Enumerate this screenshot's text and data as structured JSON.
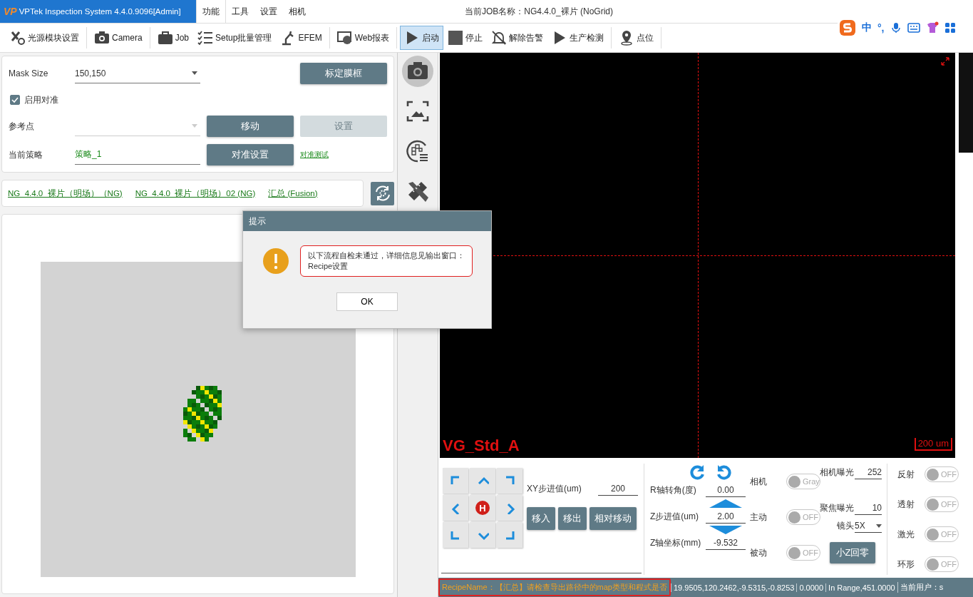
{
  "title_bar": {
    "logo": "VP",
    "app_title": "VPTek Inspection System 4.4.0.9096[Admin]",
    "menu": [
      {
        "label": "功能",
        "selected": true
      },
      {
        "label": "工具",
        "selected": false
      },
      {
        "label": "设置",
        "selected": false
      },
      {
        "label": "相机",
        "selected": false
      }
    ],
    "job_name": "当前JOB名称：NG4.4.0_裸片 (NoGrid)"
  },
  "ime_bar": {
    "items": [
      "中",
      "°,"
    ]
  },
  "toolbar": [
    {
      "items": [
        {
          "label": "光源模块设置",
          "selected": false
        }
      ]
    },
    {
      "items": [
        {
          "label": "Camera",
          "selected": false
        }
      ]
    },
    {
      "items": [
        {
          "label": "Job",
          "selected": false
        },
        {
          "label": "Setup批量管理",
          "selected": false
        },
        {
          "label": "EFEM",
          "selected": false
        }
      ]
    },
    {
      "items": [
        {
          "label": "Web报表",
          "selected": false
        }
      ]
    },
    {
      "items": [
        {
          "label": "启动",
          "selected": true
        },
        {
          "label": "停止",
          "selected": false
        },
        {
          "label": "解除告警",
          "selected": false
        },
        {
          "label": "生产检测",
          "selected": false
        }
      ]
    },
    {
      "items": [
        {
          "label": "点位",
          "selected": false
        }
      ]
    }
  ],
  "alignment": {
    "mask_size": {
      "label": "Mask Size",
      "value": "150,150"
    },
    "calibrate_button": "标定膜框",
    "enable_align": {
      "label": "启用对准",
      "checked": true
    },
    "ref_point": {
      "label": "参考点",
      "disabled": true
    },
    "move_button": {
      "label": "移动",
      "disabled": false
    },
    "set_button": {
      "label": "设置",
      "disabled": true
    },
    "strategy": {
      "label": "当前策略",
      "value": "策略_1"
    },
    "align_settings_button": "对准设置",
    "align_test_link": "对准测试"
  },
  "recipe_links": [
    "NG_4.4.0_裸片（明场）（NG)",
    "NG_4.4.0_裸片（明场）02 (NG)",
    "汇总 (Fusion)"
  ],
  "dialog": {
    "title": "提示",
    "message": [
      "以下流程自检未通过，详细信息见输出窗口：",
      "Recipe设置"
    ],
    "ok_button": "OK"
  },
  "side_tools": [
    {
      "kind": "camera",
      "selected": true
    },
    {
      "kind": "image",
      "selected": false
    },
    {
      "kind": "wafer",
      "selected": false
    },
    {
      "kind": "ruler",
      "selected": false
    }
  ],
  "viewport": {
    "recipe_label": "VG_Std_A",
    "scale": "200 um"
  },
  "motion": {
    "home_label": "H",
    "xy_step": {
      "label": "XY步进值(um)",
      "value": "200"
    },
    "buttons": [
      "移入",
      "移出",
      "相对移动"
    ],
    "r_angle": {
      "label": "R轴转角(度)",
      "value": "0.00"
    },
    "z_step": {
      "label": "Z步进值(um)",
      "value": "2.00"
    },
    "z_pos": {
      "label": "Z轴坐标(mm)",
      "value": "-9.532"
    }
  },
  "camera": {
    "modes": [
      {
        "label": "相机",
        "toggle": "Gray",
        "on": false
      },
      {
        "label": "主动",
        "toggle": "OFF",
        "on": false
      },
      {
        "label": "被动",
        "toggle": "OFF",
        "on": false
      }
    ],
    "exposure": {
      "label": "相机曝光",
      "value": "252"
    },
    "focus_exposure": {
      "label": "聚焦曝光",
      "value": "10"
    },
    "lens": {
      "label": "镜头",
      "value": "5X"
    },
    "z_home_button": "小Z回零"
  },
  "lights": [
    {
      "label": "反射",
      "toggle": "OFF",
      "on": false
    },
    {
      "label": "透射",
      "toggle": "OFF",
      "on": false
    },
    {
      "label": "激光",
      "toggle": "OFF",
      "on": false
    },
    {
      "label": "环形",
      "toggle": "OFF",
      "on": false
    }
  ],
  "status_bar": {
    "message": "RecipeName：【汇总】请检查导出路径中的map类型和程式是否",
    "coords": "19.9505,120.2462,-9.5315,-0.8253",
    "angle": "0.0000",
    "range": "In Range,451.0000",
    "user": "当前用户：s"
  }
}
